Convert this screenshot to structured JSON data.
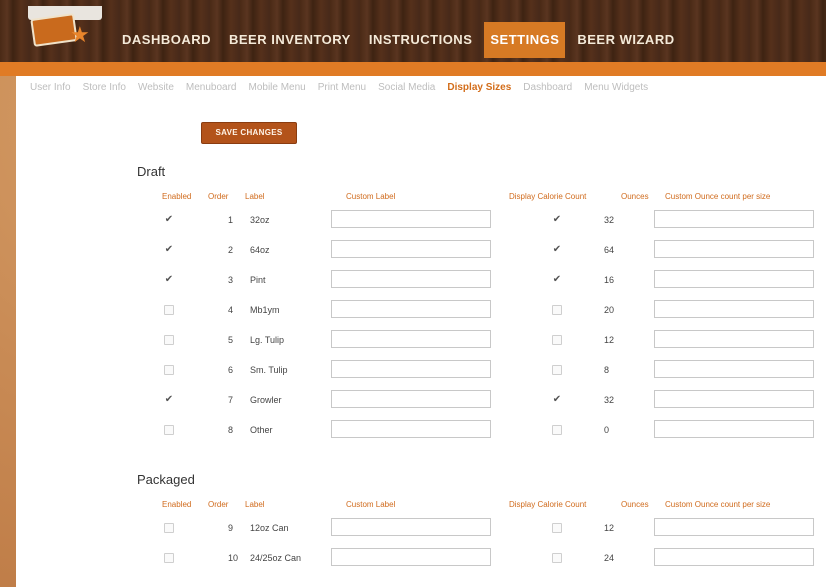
{
  "nav": {
    "items": [
      {
        "label": "Dashboard"
      },
      {
        "label": "Beer Inventory"
      },
      {
        "label": "Instructions"
      },
      {
        "label": "Settings",
        "active": true
      },
      {
        "label": "Beer Wizard"
      }
    ]
  },
  "subnav": {
    "items": [
      {
        "label": "User Info"
      },
      {
        "label": "Store Info"
      },
      {
        "label": "Website"
      },
      {
        "label": "Menuboard"
      },
      {
        "label": "Mobile Menu"
      },
      {
        "label": "Print Menu"
      },
      {
        "label": "Social Media"
      },
      {
        "label": "Display Sizes",
        "active": true
      },
      {
        "label": "Dashboard"
      },
      {
        "label": "Menu Widgets"
      }
    ]
  },
  "save_button": "SAVE CHANGES",
  "columns": {
    "enabled": "Enabled",
    "order": "Order",
    "label": "Label",
    "custom_label": "Custom Label",
    "display_calorie": "Display Calorie Count",
    "ounces": "Ounces",
    "custom_ounce": "Custom Ounce count per size"
  },
  "sections": [
    {
      "title": "Draft",
      "rows": [
        {
          "enabled": true,
          "order": "1",
          "label": "32oz",
          "custom_label": "",
          "calorie": true,
          "ounces": "32",
          "custom_ounce": ""
        },
        {
          "enabled": true,
          "order": "2",
          "label": "64oz",
          "custom_label": "",
          "calorie": true,
          "ounces": "64",
          "custom_ounce": ""
        },
        {
          "enabled": true,
          "order": "3",
          "label": "Pint",
          "custom_label": "",
          "calorie": true,
          "ounces": "16",
          "custom_ounce": ""
        },
        {
          "enabled": false,
          "order": "4",
          "label": "Mb1ym",
          "custom_label": "",
          "calorie": false,
          "ounces": "20",
          "custom_ounce": ""
        },
        {
          "enabled": false,
          "order": "5",
          "label": "Lg. Tulip",
          "custom_label": "",
          "calorie": false,
          "ounces": "12",
          "custom_ounce": ""
        },
        {
          "enabled": false,
          "order": "6",
          "label": "Sm. Tulip",
          "custom_label": "",
          "calorie": false,
          "ounces": "8",
          "custom_ounce": ""
        },
        {
          "enabled": true,
          "order": "7",
          "label": "Growler",
          "custom_label": "",
          "calorie": true,
          "ounces": "32",
          "custom_ounce": ""
        },
        {
          "enabled": false,
          "order": "8",
          "label": "Other",
          "custom_label": "",
          "calorie": false,
          "ounces": "0",
          "custom_ounce": ""
        }
      ]
    },
    {
      "title": "Packaged",
      "rows": [
        {
          "enabled": false,
          "order": "9",
          "label": "12oz Can",
          "custom_label": "",
          "calorie": false,
          "ounces": "12",
          "custom_ounce": ""
        },
        {
          "enabled": false,
          "order": "10",
          "label": "24/25oz Can",
          "custom_label": "",
          "calorie": false,
          "ounces": "24",
          "custom_ounce": ""
        }
      ]
    }
  ],
  "colors": {
    "accent": "#d77a24",
    "header_wood": "#4a2a16",
    "link_active": "#d36d1a",
    "button": "#b3531a"
  }
}
